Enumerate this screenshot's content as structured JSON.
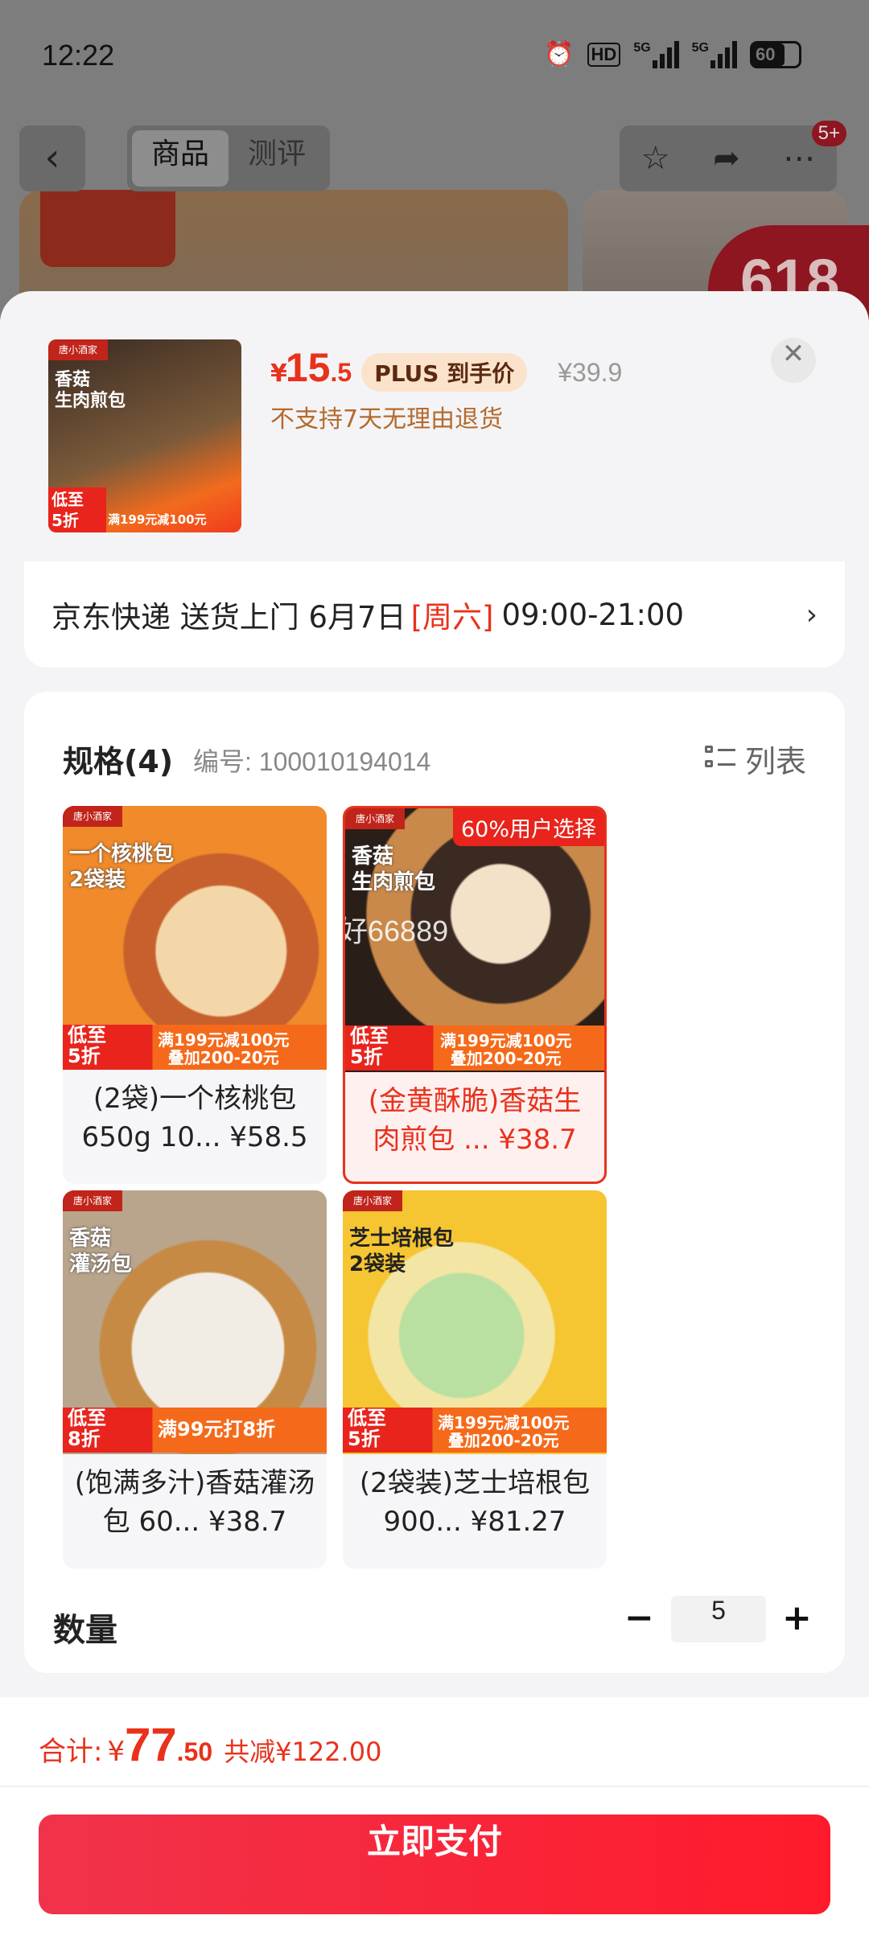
{
  "status_bar": {
    "time": "12:22",
    "hd": "HD",
    "net1": "5G",
    "net2": "5G",
    "battery": "60"
  },
  "nav": {
    "back_icon": "chevron-left-icon",
    "tabs": [
      {
        "label": "商品",
        "active": true
      },
      {
        "label": "测评",
        "active": false
      }
    ],
    "badge": "5+",
    "bg_promo": "618"
  },
  "product": {
    "currency": "¥",
    "price_int": "15",
    "price_dec": ".5",
    "plus_label": "PLUS 到手价",
    "original_price": "¥39.9",
    "return_note": "不支持7天无理由退货",
    "thumb_text": "香菇\n生肉煎包",
    "thumb_brand": "唐小酒家",
    "thumb_low": "低至\n5折",
    "thumb_promo": "满199元减100元"
  },
  "shipping": {
    "text": "京东快递 送货上门 6月7日",
    "weekday": "[周六]",
    "time": "09:00-21:00",
    "arrow": "›"
  },
  "spec": {
    "title": "规格(4)",
    "number": "编号: 100010194014",
    "list_label": "列表",
    "items": [
      {
        "name": "(2袋)一个核桃包 650g 10... ¥58.5",
        "tag": "一个核桃包\n2袋装",
        "low": "低至\n5折",
        "promo": "满199元减100元\n叠加200-20元",
        "selected": false,
        "popular": ""
      },
      {
        "name": "(金黄酥脆)香菇生肉煎包 ... ¥38.7",
        "tag": "香菇\n生肉煎包",
        "low": "低至\n5折",
        "promo": "满199元减100元\n叠加200-20元",
        "selected": true,
        "popular": "60%用户选择"
      },
      {
        "name": "(饱满多汁)香菇灌汤包 60... ¥38.7",
        "tag": "香菇\n灌汤包",
        "low": "低至\n8折",
        "promo": "满99元打8折",
        "selected": false,
        "popular": ""
      },
      {
        "name": "(2袋装)芝士培根包 900... ¥81.27",
        "tag": "芝士培根包\n2袋装",
        "low": "低至\n5折",
        "promo": "满199元减100元\n叠加200-20元",
        "selected": false,
        "popular": ""
      }
    ],
    "watermark": "好66889"
  },
  "quantity": {
    "label": "数量",
    "value": "5",
    "minus": "−",
    "plus": "+"
  },
  "summary": {
    "label": "合计:",
    "yen": "¥",
    "int": "77",
    "dec": ".50",
    "saving": "共减¥122.00"
  },
  "pay_button": "立即支付",
  "colors": {
    "accent": "#e8321c",
    "pay": "#ff1a2b",
    "plus_bg": "#fbe3cb"
  }
}
